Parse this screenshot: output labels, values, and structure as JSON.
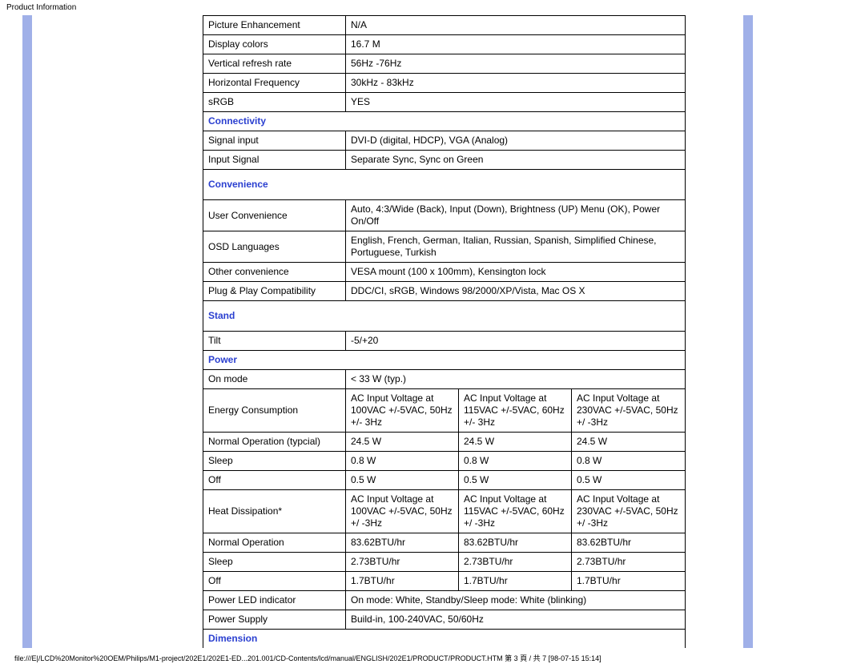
{
  "page_title": "Product Information",
  "footer": "file:///E|/LCD%20Monitor%20OEM/Philips/M1-project/202E1/202E1-ED...201.001/CD-Contents/lcd/manual/ENGLISH/202E1/PRODUCT/PRODUCT.HTM 第 3 頁 / 共 7  [98-07-15 15:14]",
  "rows_top": [
    {
      "label": "Picture Enhancement",
      "value": "N/A"
    },
    {
      "label": "Display colors",
      "value": "16.7 M"
    },
    {
      "label": "Vertical refresh rate",
      "value": "56Hz -76Hz"
    },
    {
      "label": "Horizontal Frequency",
      "value": "30kHz - 83kHz"
    },
    {
      "label": "sRGB",
      "value": "YES"
    }
  ],
  "section_connectivity": "Connectivity",
  "rows_connectivity": [
    {
      "label": "Signal input",
      "value": "DVI-D (digital, HDCP), VGA (Analog)"
    },
    {
      "label": "Input Signal",
      "value": "Separate Sync, Sync on Green"
    }
  ],
  "section_convenience": "Convenience",
  "rows_convenience": [
    {
      "label": "User Convenience",
      "value": "Auto, 4:3/Wide (Back), Input (Down), Brightness (UP) Menu (OK), Power On/Off"
    },
    {
      "label": "OSD Languages",
      "value": "English, French, German, Italian, Russian, Spanish, Simplified Chinese, Portuguese, Turkish"
    },
    {
      "label": "Other convenience",
      "value": "VESA mount (100 x 100mm), Kensington lock"
    },
    {
      "label": "Plug & Play Compatibility",
      "value": "DDC/CI, sRGB, Windows 98/2000/XP/Vista, Mac OS X"
    }
  ],
  "section_stand": "Stand",
  "rows_stand": [
    {
      "label": "Tilt",
      "value": "-5/+20"
    }
  ],
  "section_power": "Power",
  "power_onmode": {
    "label": "On mode",
    "value": "< 33 W (typ.)"
  },
  "power_energy_row": {
    "label": "Energy Consumption",
    "c1": "AC Input Voltage at 100VAC +/-5VAC, 50Hz +/- 3Hz",
    "c2": "AC Input Voltage at 115VAC +/-5VAC, 60Hz +/- 3Hz",
    "c3": "AC Input Voltage at 230VAC +/-5VAC, 50Hz +/ -3Hz"
  },
  "power_rows3": [
    {
      "label": "Normal Operation (typcial)",
      "c1": "24.5 W",
      "c2": "24.5 W",
      "c3": "24.5 W"
    },
    {
      "label": "Sleep",
      "c1": "0.8 W",
      "c2": "0.8 W",
      "c3": "0.8 W"
    },
    {
      "label": "Off",
      "c1": "0.5 W",
      "c2": "0.5 W",
      "c3": "0.5 W"
    }
  ],
  "power_heat_row": {
    "label": "Heat Dissipation*",
    "c1": "AC Input Voltage at 100VAC +/-5VAC, 50Hz +/ -3Hz",
    "c2": "AC Input Voltage at 115VAC +/-5VAC, 60Hz +/ -3Hz",
    "c3": "AC Input Voltage at 230VAC +/-5VAC, 50Hz +/ -3Hz"
  },
  "power_heat_rows3": [
    {
      "label": "Normal Operation",
      "c1": "83.62BTU/hr",
      "c2": "83.62BTU/hr",
      "c3": "83.62BTU/hr"
    },
    {
      "label": "Sleep",
      "c1": "2.73BTU/hr",
      "c2": "2.73BTU/hr",
      "c3": "2.73BTU/hr"
    },
    {
      "label": "Off",
      "c1": "1.7BTU/hr",
      "c2": "1.7BTU/hr",
      "c3": "1.7BTU/hr"
    }
  ],
  "power_led": {
    "label": "Power LED indicator",
    "value": "On mode: White, Standby/Sleep mode: White (blinking)"
  },
  "power_supply": {
    "label": "Power Supply",
    "value": "Build-in, 100-240VAC, 50/60Hz"
  },
  "section_dimension": "Dimension"
}
